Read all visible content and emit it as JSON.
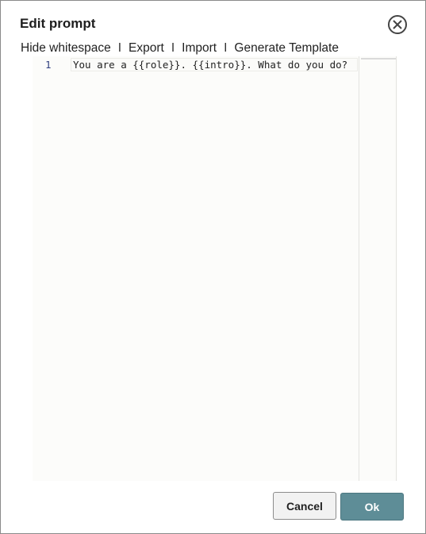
{
  "dialog": {
    "title": "Edit prompt",
    "close_icon": "close-circle-icon"
  },
  "toolbar": {
    "hide_whitespace": "Hide whitespace",
    "export": "Export",
    "import": "Import",
    "generate_template": "Generate Template",
    "separator": "I"
  },
  "editor": {
    "lines": [
      {
        "number": "1",
        "text": "You are a {{role}}. {{intro}}. What do you do?"
      }
    ]
  },
  "buttons": {
    "cancel": "Cancel",
    "ok": "Ok"
  },
  "colors": {
    "ok_button": "#5e8d97",
    "line_number": "#2f3f7f"
  }
}
